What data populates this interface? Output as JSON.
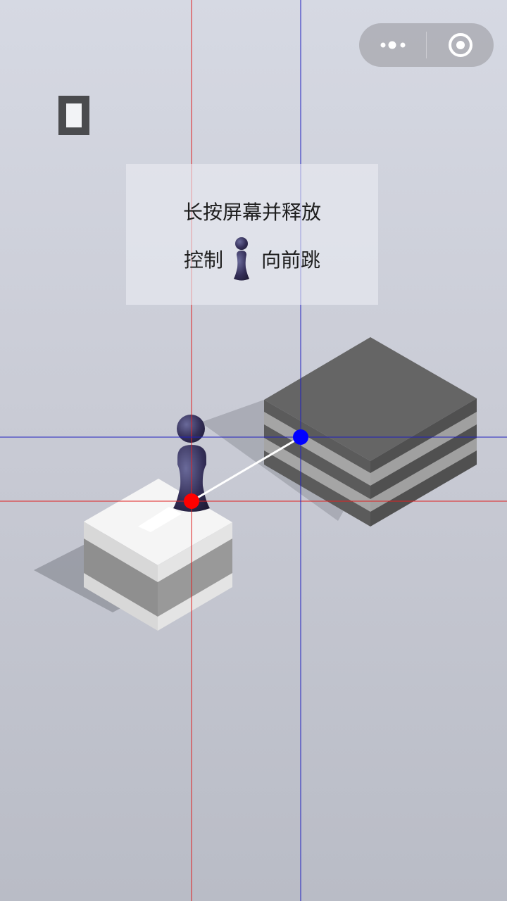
{
  "menu_capsule": {
    "more_icon": "three-dots-icon",
    "close_icon": "target-circle-icon"
  },
  "score": {
    "display": ""
  },
  "hint": {
    "line1": "长按屏幕并释放",
    "line2_prefix": "控制",
    "line2_suffix": "向前跳",
    "icon": "chess-piece-icon"
  },
  "colors": {
    "piece": "#3a3560",
    "current_block_top": "#f4f4f4",
    "target_block_top": "#666666",
    "start_marker": "#ff0000",
    "target_marker": "#0000ff",
    "start_guide": "#e02020",
    "target_guide": "#2020c0"
  }
}
